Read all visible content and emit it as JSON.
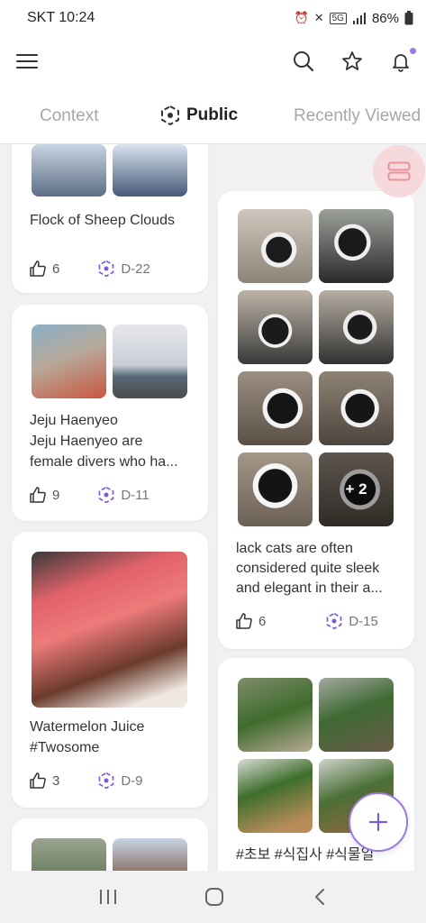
{
  "status_bar": {
    "carrier_time": "SKT 10:24",
    "network": "5G",
    "battery": "86%"
  },
  "app_bar": {
    "menu_icon": "hamburger-icon",
    "search_icon": "search-icon",
    "favorites_icon": "star-icon",
    "notifications_icon": "bell-icon",
    "notification_dot_color": "#9b7be3"
  },
  "tabs": [
    {
      "label": "Context",
      "active": false
    },
    {
      "label": "Public",
      "active": true
    },
    {
      "label": "Recently Viewed",
      "active": false
    }
  ],
  "layout_toggle": {
    "icon": "stacked-rows-icon",
    "color": "#e8949c"
  },
  "accent_color": "#7b5bd6",
  "feed": {
    "left_column": [
      {
        "title": "Flock of Sheep Clouds",
        "likes": "6",
        "dday": "D-22"
      },
      {
        "title": "Jeju Haenyeo",
        "subtitle": "Jeju Haenyeo are",
        "subtitle2": "female divers who ha...",
        "likes": "9",
        "dday": "D-11"
      },
      {
        "title": "Watermelon Juice",
        "subtitle": "#Twosome",
        "likes": "3",
        "dday": "D-9"
      }
    ],
    "right_column": [
      {
        "line1": "lack cats are often",
        "line2": "considered quite sleek",
        "line3": "and elegant in their a...",
        "more_photos": "+ 2",
        "likes": "6",
        "dday": "D-15"
      },
      {
        "hashtags": "#초보 #식집사 #식물일"
      }
    ]
  },
  "fab": {
    "icon": "plus-icon"
  },
  "nav_bar": {
    "recents_icon": "recents-icon",
    "home_icon": "home-icon",
    "back_icon": "back-icon"
  }
}
